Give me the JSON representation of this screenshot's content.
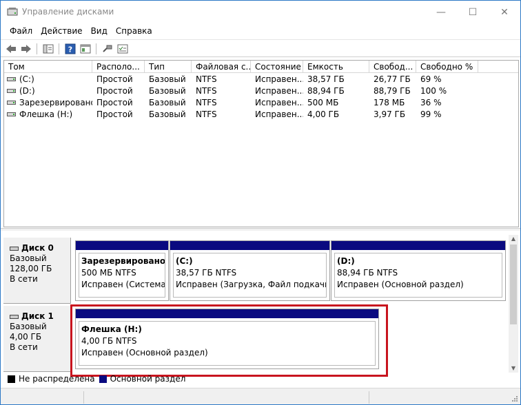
{
  "window": {
    "title": "Управление дисками",
    "minimize": "—",
    "maximize": "☐",
    "close": "✕"
  },
  "menu": [
    "Файл",
    "Действие",
    "Вид",
    "Справка"
  ],
  "volumes": {
    "columns": [
      "Том",
      "Располо...",
      "Тип",
      "Файловая с...",
      "Состояние",
      "Емкость",
      "Свобод...",
      "Свободно %"
    ],
    "rows": [
      [
        "(C:)",
        "Простой",
        "Базовый",
        "NTFS",
        "Исправен...",
        "38,57 ГБ",
        "26,77 ГБ",
        "69 %"
      ],
      [
        "(D:)",
        "Простой",
        "Базовый",
        "NTFS",
        "Исправен...",
        "88,94 ГБ",
        "88,79 ГБ",
        "100 %"
      ],
      [
        "Зарезервировано...",
        "Простой",
        "Базовый",
        "NTFS",
        "Исправен...",
        "500 МБ",
        "178 МБ",
        "36 %"
      ],
      [
        "Флешка (H:)",
        "Простой",
        "Базовый",
        "NTFS",
        "Исправен...",
        "4,00 ГБ",
        "3,97 ГБ",
        "99 %"
      ]
    ]
  },
  "disks": [
    {
      "name": "Диск 0",
      "type": "Базовый",
      "size": "128,00 ГБ",
      "state": "В сети",
      "partitions": [
        {
          "title": "Зарезервировано си",
          "size": "500 МБ NTFS",
          "status": "Исправен (Система, А"
        },
        {
          "title": "(C:)",
          "size": "38,57 ГБ NTFS",
          "status": "Исправен (Загрузка, Файл подкачки, Ав"
        },
        {
          "title": "(D:)",
          "size": "88,94 ГБ NTFS",
          "status": "Исправен (Основной раздел)"
        }
      ]
    },
    {
      "name": "Диск 1",
      "type": "Базовый",
      "size": "4,00 ГБ",
      "state": "В сети",
      "partitions": [
        {
          "title": "Флешка  (H:)",
          "size": "4,00 ГБ NTFS",
          "status": "Исправен (Основной раздел)"
        }
      ]
    }
  ],
  "legend": [
    {
      "label": "Не распределена",
      "color": "#000000"
    },
    {
      "label": "Основной раздел",
      "color": "#0a0a80"
    }
  ],
  "colors": {
    "accent_highlight": "#c8141e",
    "partition_bar": "#0a0a80",
    "window_border": "#2b78c6"
  }
}
